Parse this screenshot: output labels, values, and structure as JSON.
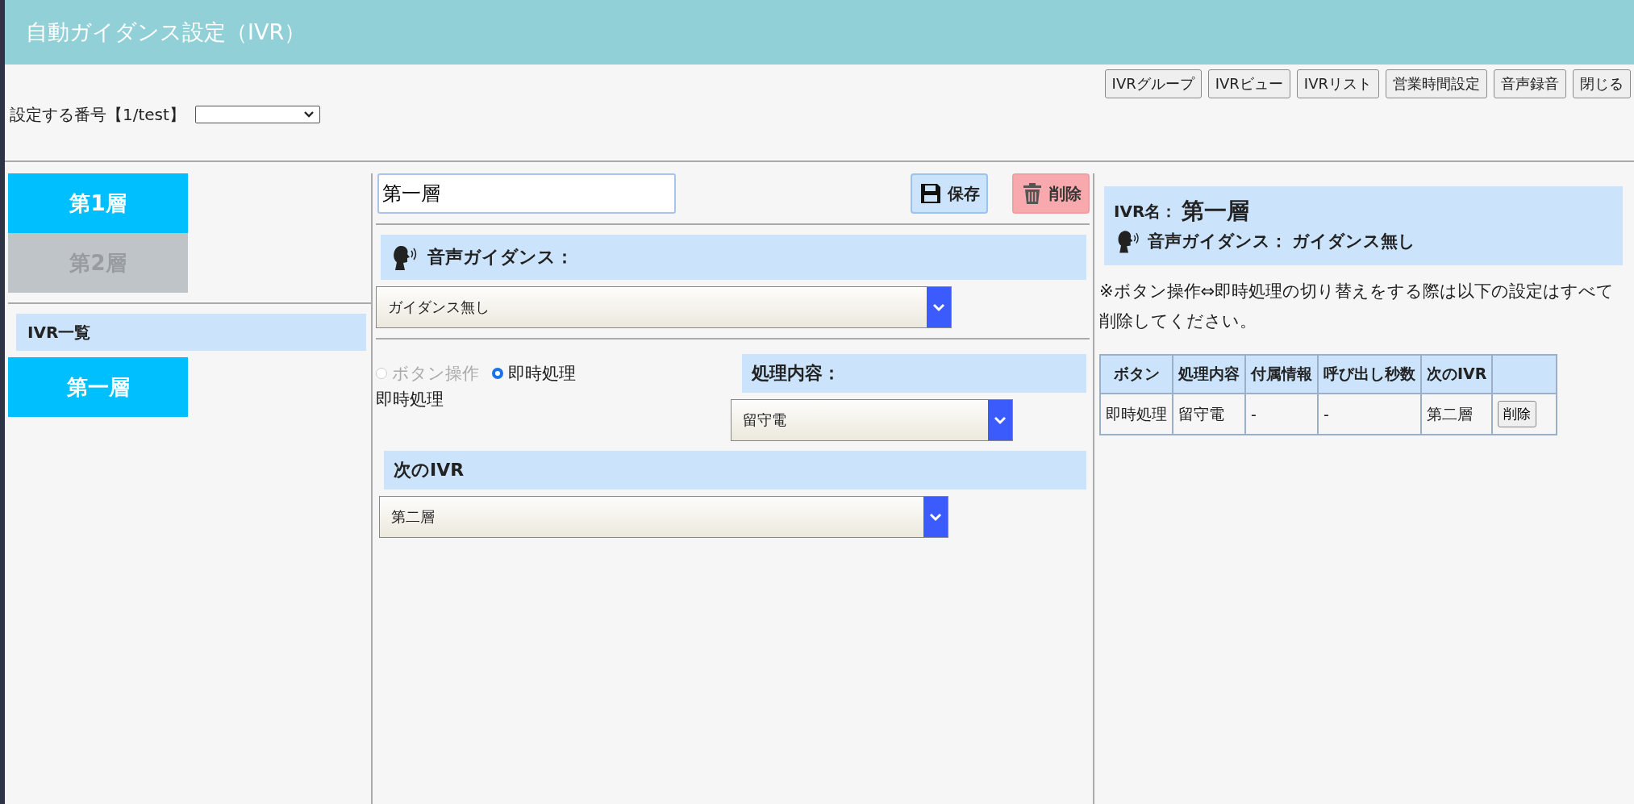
{
  "header": {
    "title": "自動ガイダンス設定（IVR）"
  },
  "toolbar": [
    {
      "label": "IVRグループ"
    },
    {
      "label": "IVRビュー"
    },
    {
      "label": "IVRリスト"
    },
    {
      "label": "営業時間設定"
    },
    {
      "label": "音声録音"
    },
    {
      "label": "閉じる"
    }
  ],
  "number_selector": {
    "label": "設定する番号【1/test】"
  },
  "layers": [
    {
      "label": "第1層",
      "selected": true
    },
    {
      "label": "第2層",
      "selected": false
    }
  ],
  "ivr_list": {
    "title": "IVR一覧",
    "items": [
      {
        "label": "第一層",
        "selected": true
      }
    ]
  },
  "editor": {
    "name_value": "第一層",
    "save": "保存",
    "delete": "削除",
    "guidance_label": "音声ガイダンス：",
    "guidance_value": "ガイダンス無し",
    "modes": [
      {
        "label": "ボタン操作",
        "selected": false,
        "disabled": true
      },
      {
        "label": "即時処理",
        "selected": true,
        "disabled": false
      }
    ],
    "mode_text": "即時処理",
    "action_label": "処理内容：",
    "action_value": "留守電",
    "next_label": "次のIVR",
    "next_value": "第二層"
  },
  "summary": {
    "name_label": "IVR名：",
    "name": "第一層",
    "guidance_label": "音声ガイダンス：",
    "guidance": "ガイダンス無し",
    "note": "※ボタン操作⇔即時処理の切り替えをする際は以下の設定はすべて削除してください。",
    "table": {
      "columns": [
        "ボタン",
        "処理内容",
        "付属情報",
        "呼び出し秒数",
        "次のIVR"
      ],
      "rows": [
        {
          "cells": [
            "即時処理",
            "留守電",
            "-",
            "-",
            "第二層"
          ],
          "action": "削除"
        }
      ]
    }
  }
}
